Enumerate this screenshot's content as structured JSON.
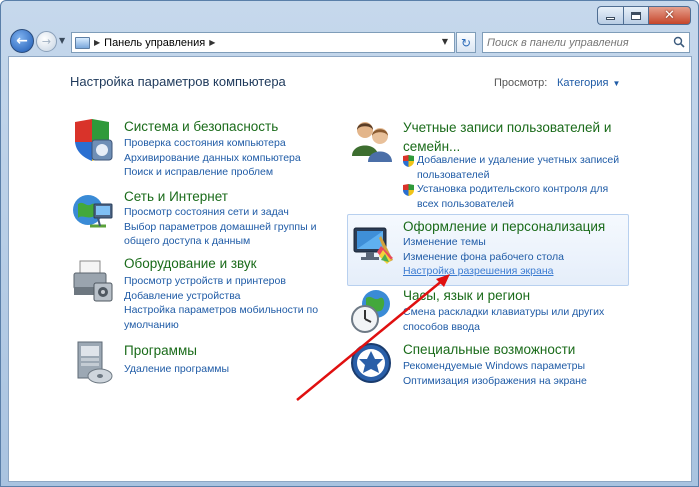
{
  "window": {
    "caption_buttons": [
      "minimize",
      "maximize",
      "close"
    ]
  },
  "toolbar": {
    "address_path": "Панель управления",
    "search_placeholder": "Поиск в панели управления"
  },
  "page": {
    "heading": "Настройка параметров компьютера",
    "view_label": "Просмотр:",
    "view_value": "Категория"
  },
  "categories_left": [
    {
      "title": "Система и безопасность",
      "icon": "shield-pc-icon",
      "links": [
        "Проверка состояния компьютера",
        "Архивирование данных компьютера",
        "Поиск и исправление проблем"
      ]
    },
    {
      "title": "Сеть и Интернет",
      "icon": "network-globe-icon",
      "links": [
        "Просмотр состояния сети и задач",
        "Выбор параметров домашней группы и",
        "общего доступа к данным"
      ]
    },
    {
      "title": "Оборудование и звук",
      "icon": "printer-icon",
      "links": [
        "Просмотр устройств и принтеров",
        "Добавление устройства",
        "Настройка параметров мобильности по",
        "умолчанию"
      ]
    },
    {
      "title": "Программы",
      "icon": "programs-icon",
      "links": [
        "Удаление программы"
      ]
    }
  ],
  "categories_right": [
    {
      "title_lines": [
        "Учетные записи пользователей и",
        "семейн..."
      ],
      "icon": "users-icon",
      "links": [
        "Добавление и удаление учетных записей",
        "пользователей",
        "Установка родительского контроля для",
        "всех пользователей"
      ]
    },
    {
      "title": "Оформление и персонализация",
      "icon": "personalization-icon",
      "links": [
        "Изменение темы",
        "Изменение фона рабочего стола",
        "Настройка разрешения экрана"
      ]
    },
    {
      "title": "Часы, язык и регион",
      "icon": "clock-globe-icon",
      "links": [
        "Смена раскладки клавиатуры или других",
        "способов ввода"
      ]
    },
    {
      "title": "Специальные возможности",
      "icon": "accessibility-icon",
      "links": [
        "Рекомендуемые Windows параметры",
        "Оптимизация изображения на экране"
      ]
    }
  ],
  "colors": {
    "category_title": "#1a6b1a",
    "link": "#1f5ba6",
    "annotation_arrow": "#e01010"
  }
}
